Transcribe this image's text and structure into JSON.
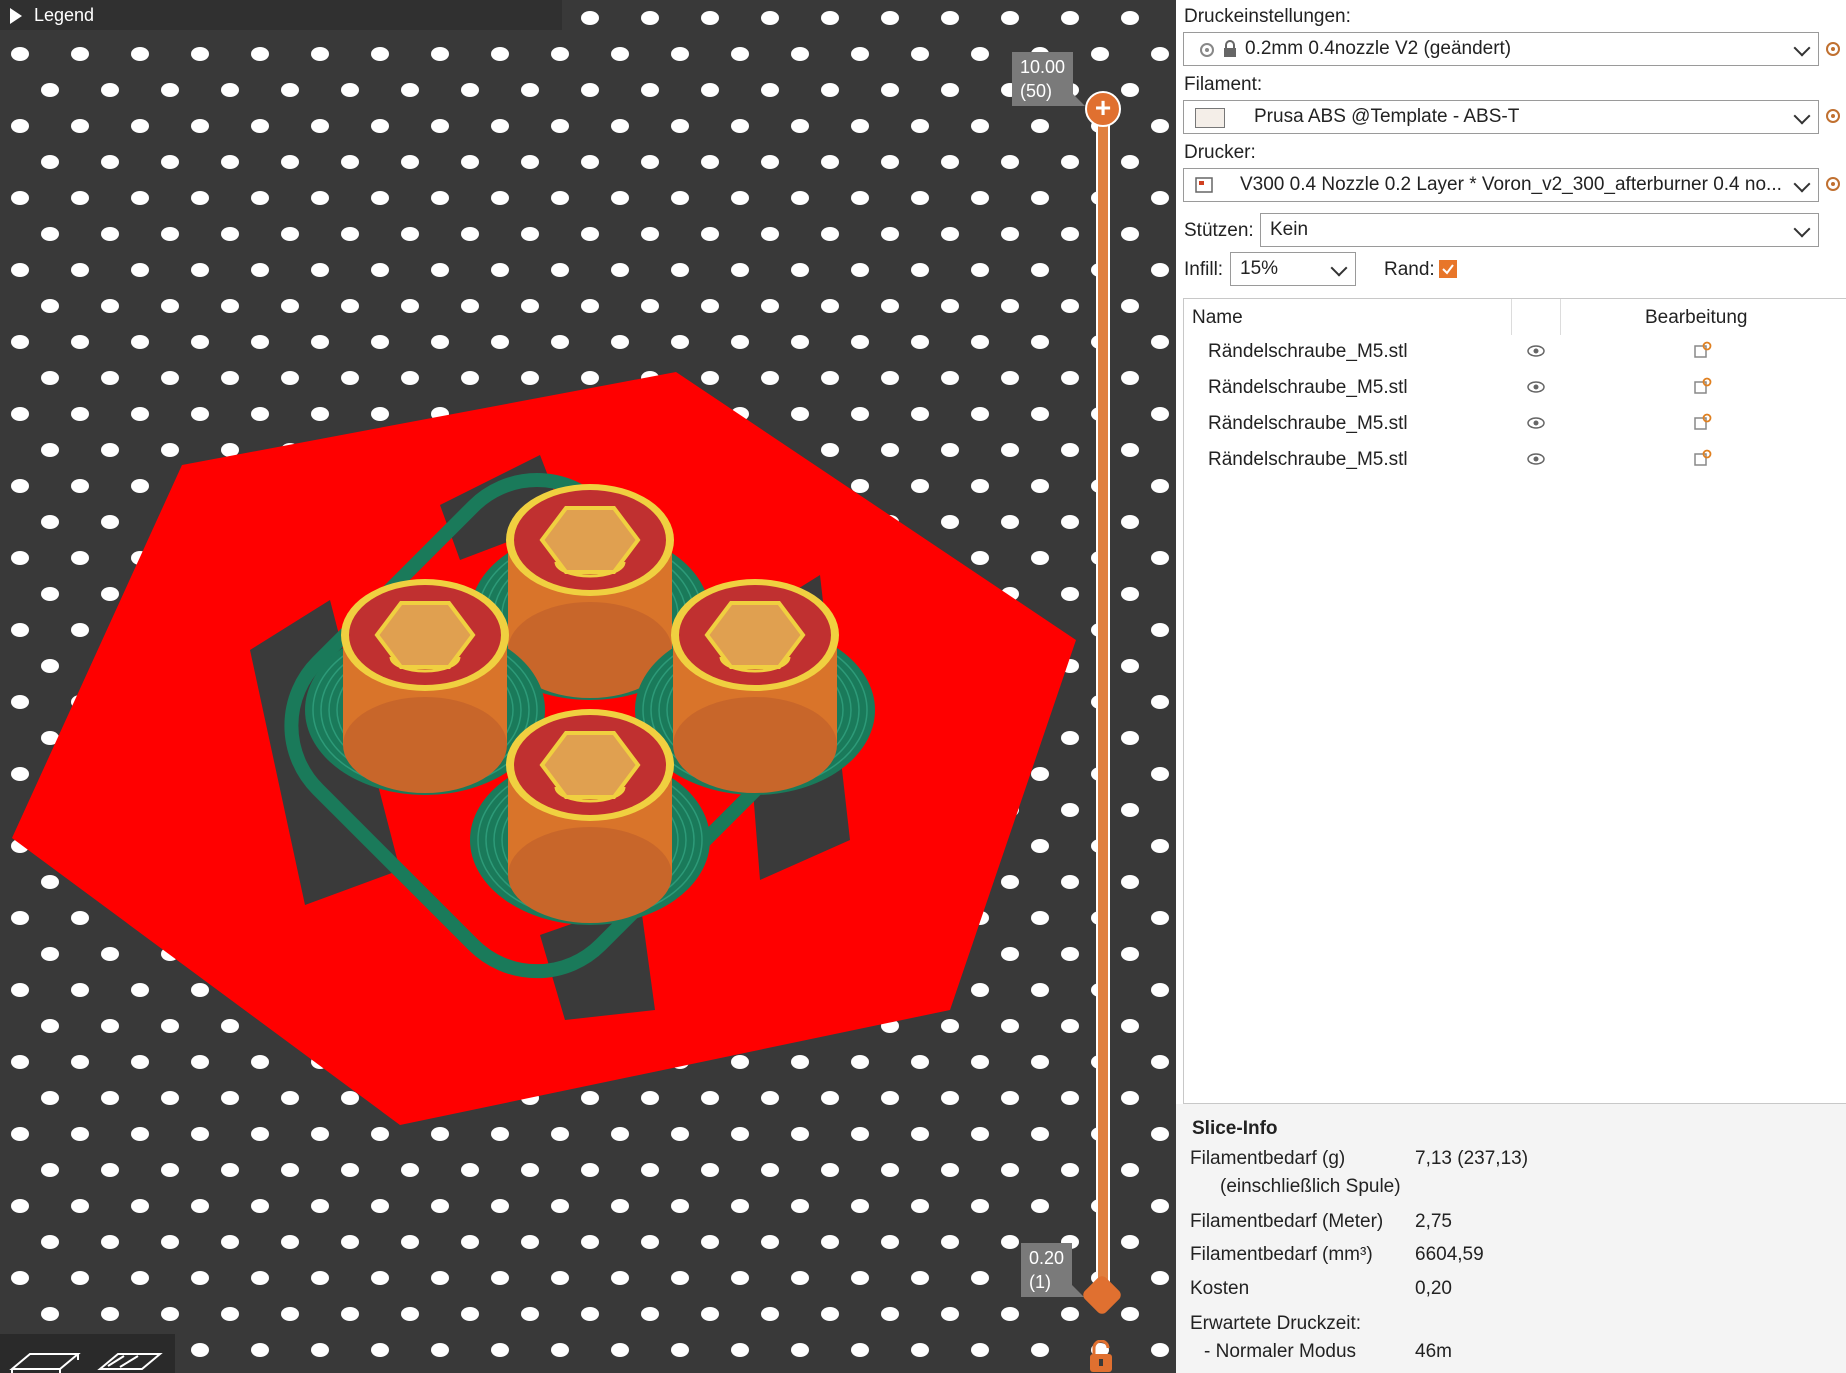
{
  "viewport": {
    "legend_label": "Legend",
    "layer_top": {
      "height": "10.00",
      "layer": "(50)"
    },
    "layer_bottom": {
      "height": "0.20",
      "layer": "(1)"
    }
  },
  "settings": {
    "print_label": "Druckeinstellungen:",
    "print_value": "0.2mm 0.4nozzle V2 (geändert)",
    "filament_label": "Filament:",
    "filament_value": "Prusa ABS @Template - ABS-T",
    "printer_label": "Drucker:",
    "printer_value": "V300 0.4 Nozzle 0.2 Layer * Voron_v2_300_afterburner 0.4 no...",
    "supports_label": "Stützen:",
    "supports_value": "Kein",
    "infill_label": "Infill:",
    "infill_value": "15%",
    "brim_label": "Rand:",
    "brim_checked": true
  },
  "object_list": {
    "col_name": "Name",
    "col_edit": "Bearbeitung",
    "items": [
      {
        "name": "Rändelschraube_M5.stl"
      },
      {
        "name": "Rändelschraube_M5.stl"
      },
      {
        "name": "Rändelschraube_M5.stl"
      },
      {
        "name": "Rändelschraube_M5.stl"
      }
    ]
  },
  "slice_info": {
    "title": "Slice-Info",
    "rows": [
      {
        "label": "Filamentbedarf (g)",
        "value": "7,13 (237,13)"
      },
      {
        "label": "(einschließlich Spule)",
        "value": ""
      },
      {
        "label": "Filamentbedarf (Meter)",
        "value": "2,75"
      },
      {
        "label": "Filamentbedarf (mm³)",
        "value": "6604,59"
      },
      {
        "label": "Kosten",
        "value": "0,20"
      },
      {
        "label": "Erwartete Druckzeit:",
        "value": ""
      },
      {
        "label": "- Normaler Modus",
        "value": "46m"
      }
    ]
  },
  "colors": {
    "viewport_bg": "#393939",
    "bed_dots": "#ffffff",
    "skirt_red": "#ff0000",
    "brim_green": "#1a7a5a",
    "part_orange": "#d9742a",
    "top_yellow": "#f0d040",
    "slider_orange": "#e07030",
    "checkbox_orange": "#e8762a"
  }
}
